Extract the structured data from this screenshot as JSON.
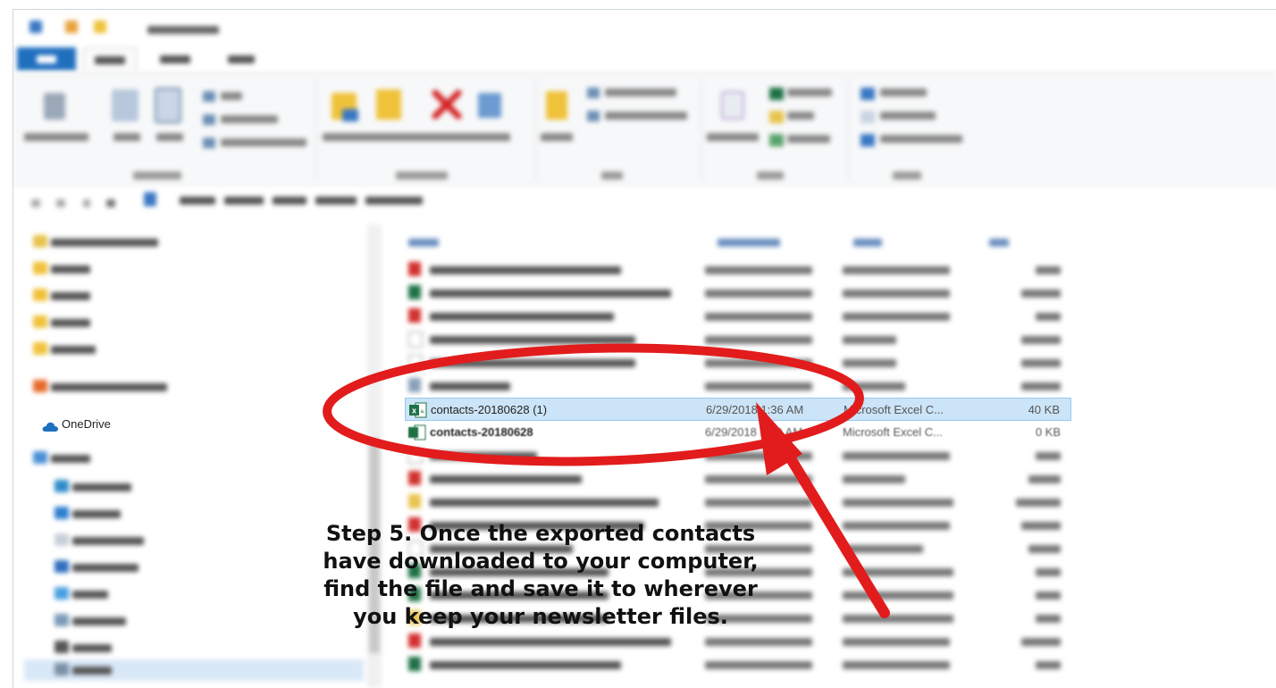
{
  "nav": {
    "onedrive_label": "OneDrive"
  },
  "files": {
    "selected": {
      "name": "contacts-20180628 (1)",
      "date": "6/29/2018 1:36 AM",
      "type": "Microsoft Excel C...",
      "size": "40 KB"
    },
    "next": {
      "name": "contacts-20180628",
      "date": "6/29/2018 1:39 AM",
      "type": "Microsoft Excel C...",
      "size": "0 KB"
    }
  },
  "caption": {
    "line1": "Step 5. Once the exported contacts",
    "line2": "have downloaded to your computer,",
    "line3": "find the file and save it to wherever",
    "line4": "you keep your newsletter files."
  },
  "colors": {
    "annotation": "#e21c1c",
    "selection": "#cce4f7",
    "file_tab": "#1f6fbf",
    "excel_icon": "#1e7145"
  },
  "icons": [
    "excel-icon",
    "onedrive-icon",
    "folder-icon",
    "pdf-icon",
    "delete-x-icon",
    "copy-icon",
    "paste-icon"
  ]
}
